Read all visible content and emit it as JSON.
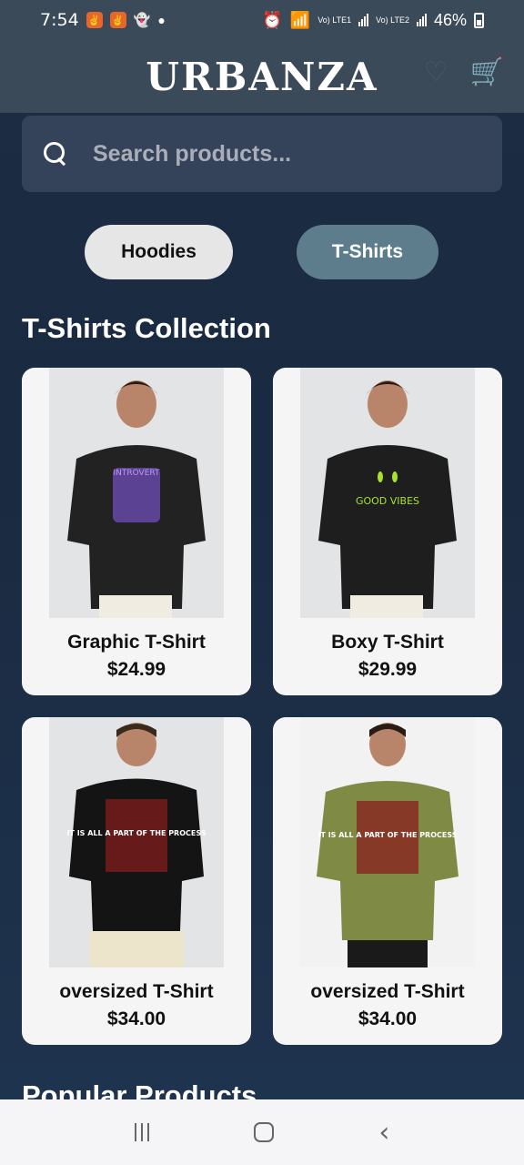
{
  "status_bar": {
    "time": "7:54",
    "battery": "46%",
    "lte1": "Vo) LTE1",
    "lte2": "Vo) LTE2",
    "icons": [
      "app-badge-icon",
      "app-badge-icon",
      "snapchat-icon",
      "dot-icon",
      "alarm-icon",
      "wifi-icon",
      "signal-icon",
      "battery-icon"
    ]
  },
  "header": {
    "brand": "URBANZA",
    "icons": [
      "heart-icon",
      "cart-icon"
    ]
  },
  "search": {
    "placeholder": "Search products..."
  },
  "tabs": [
    {
      "label": "Hoodies",
      "active": false
    },
    {
      "label": "T-Shirts",
      "active": true
    }
  ],
  "section": {
    "title": "T-Shirts Collection"
  },
  "products": [
    {
      "name": "Graphic T-Shirt",
      "price": "$24.99",
      "shirt_color": "#222222",
      "print_text": "INTROVERT"
    },
    {
      "name": "Boxy T-Shirt",
      "price": "$29.99",
      "shirt_color": "#1e1e1e",
      "print_text": "GOOD VIBES"
    },
    {
      "name": "oversized T-Shirt",
      "price": "$34.00",
      "shirt_color": "#141414",
      "print_text": "IT IS ALL A PART OF THE PROCESS"
    },
    {
      "name": "oversized T-Shirt",
      "price": "$34.00",
      "shirt_color": "#7f8a45",
      "print_text": "IT IS ALL A PART OF THE PROCESS"
    }
  ],
  "popular": {
    "title": "Popular Products"
  },
  "colors": {
    "header_bg": "#3a4a58",
    "page_bg": "#1c2d44",
    "active_tab": "#5e7d8c",
    "inactive_tab": "#e6e6e6"
  }
}
